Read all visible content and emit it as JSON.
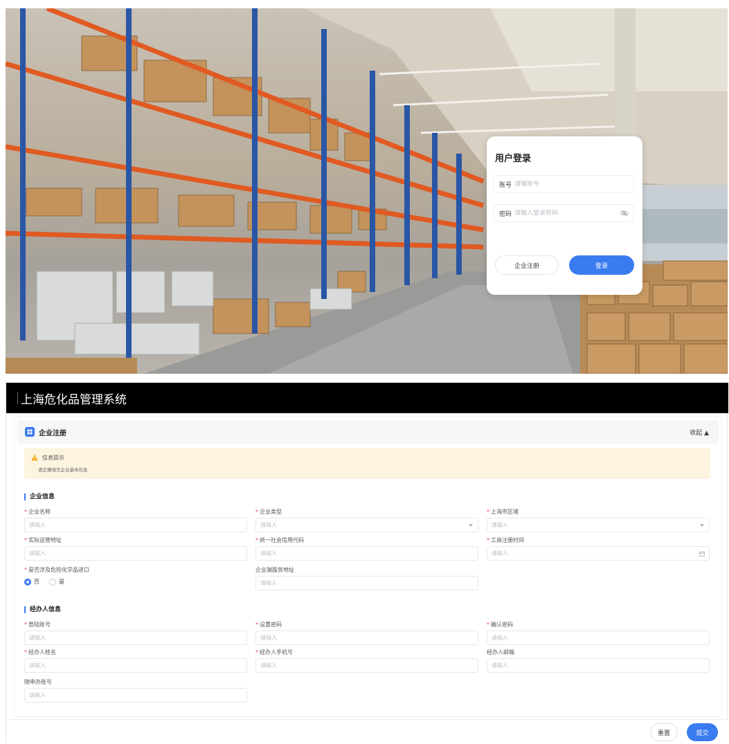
{
  "login": {
    "title": "用户登录",
    "account_label": "账号",
    "account_placeholder": "请输账号",
    "password_label": "密码",
    "password_placeholder": "请输入登录密码",
    "register_button": "企业注册",
    "login_button": "登录"
  },
  "app": {
    "title": "上海危化品管理系统"
  },
  "form": {
    "card_title": "企业注册",
    "collapse_label": "收起 ▲",
    "alert": {
      "title": "信息提示",
      "description": "请正确填写企业基本信息"
    },
    "sections": {
      "company": "企业信息",
      "agent": "经办人信息"
    },
    "placeholder": "请输入",
    "fields": {
      "company_name": "企业名称",
      "company_type": "企业类型",
      "district": "上海市区域",
      "address": "实际运营地址",
      "credit_code": "统一社会信用代码",
      "reg_time": "工商注册时间",
      "hazard_import": "是否涉及危险化学品进口",
      "service_address": "企业端服务地址",
      "login_account": "登陆账号",
      "set_password": "设置密码",
      "confirm_password": "确认密码",
      "agent_name": "经办人姓名",
      "agent_phone": "经办人手机号",
      "agent_email": "经办人邮箱",
      "suishenban_account": "随申办账号"
    },
    "radio": {
      "no": "否",
      "yes": "是",
      "selected": "否"
    },
    "buttons": {
      "reset": "重置",
      "submit": "提交"
    }
  }
}
